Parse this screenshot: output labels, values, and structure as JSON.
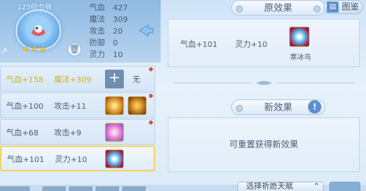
{
  "pet": {
    "title": "125级血脉",
    "stars": "★★★",
    "stats": [
      {
        "key": "气血",
        "value": "427"
      },
      {
        "key": "魔法",
        "value": "309"
      },
      {
        "key": "攻击",
        "value": "20"
      },
      {
        "key": "防御",
        "value": "0"
      },
      {
        "key": "灵力",
        "value": "10"
      }
    ]
  },
  "list": [
    {
      "a": "气血+158",
      "b": "魔法+309",
      "extra": "无",
      "highlight": true,
      "icons": [
        "add-icon"
      ],
      "dot": true
    },
    {
      "a": "气血+100",
      "b": "攻击+11",
      "highlight": false,
      "icons": [
        "gold-burst-icon",
        "gold-swirl-icon"
      ],
      "dot": true
    },
    {
      "a": "气血+68",
      "b": "攻击+9",
      "highlight": false,
      "icons": [
        "pink-flower-icon"
      ],
      "dot": true
    },
    {
      "a": "气血+101",
      "b": "灵力+10",
      "highlight": false,
      "selected": true,
      "icons": [
        "ice-bird-icon"
      ]
    }
  ],
  "original": {
    "header": "原效果",
    "stat_a": "气血+101",
    "stat_b": "灵力+10",
    "skill_name": "寒冰鸟"
  },
  "tujian_label": "图鉴",
  "new_effect": {
    "header": "新效果",
    "hint": "!",
    "text": "可重置获得新效果"
  },
  "bottom": {
    "button_label": "选择祈愿天赋"
  },
  "colors": {
    "highlight_text": "#d4b21e",
    "selected_border": "#f1d66a",
    "accent_blue": "#5b8fd0"
  }
}
